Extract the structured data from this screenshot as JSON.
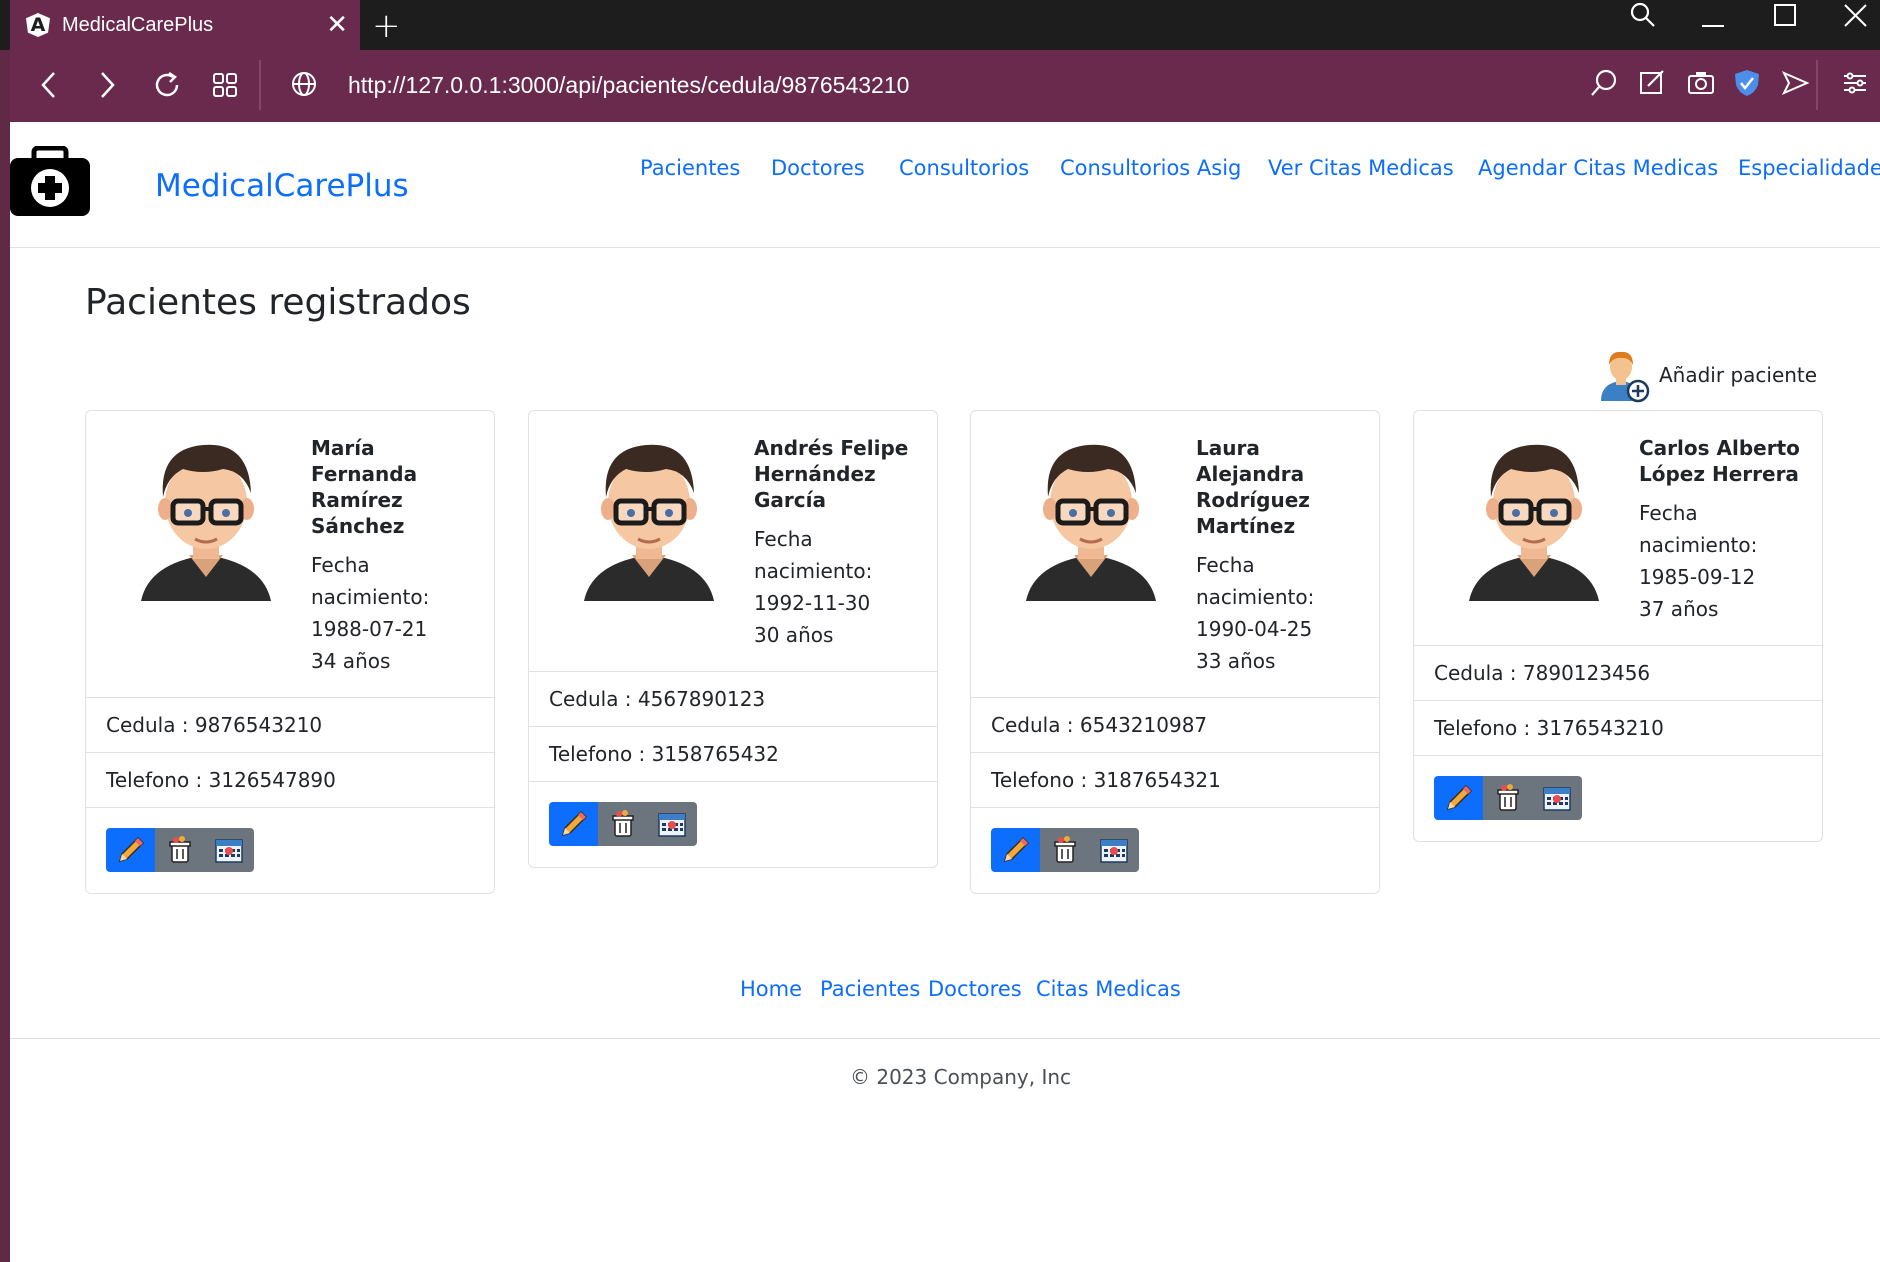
{
  "browser": {
    "tab_title": "MedicalCarePlus",
    "url": "http://127.0.0.1:3000/api/pacientes/cedula/9876543210",
    "colors": {
      "tabbar": "#1d1d1d",
      "chrome": "#692a4d"
    }
  },
  "site": {
    "brand": "MedicalCarePlus",
    "nav": [
      "Pacientes",
      "Doctores",
      "Consultorios",
      "Consultorios Asig",
      "Ver Citas Medicas",
      "Agendar Citas Medicas",
      "Especialidades"
    ]
  },
  "main": {
    "title": "Pacientes registrados",
    "add_patient_label": "Añadir paciente",
    "patients": [
      {
        "name": "María Fernanda Ramírez Sánchez",
        "birth_label": "Fecha nacimiento:",
        "birth_date": "1988-07-21",
        "age": "34 años",
        "cedula": "Cedula : 9876543210",
        "telefono": "Telefono : 3126547890"
      },
      {
        "name": "Andrés Felipe Hernández García",
        "birth_label": "Fecha nacimiento:",
        "birth_date": "1992-11-30",
        "age": "30 años",
        "cedula": "Cedula : 4567890123",
        "telefono": "Telefono : 3158765432"
      },
      {
        "name": "Laura Alejandra Rodríguez Martínez",
        "birth_label": "Fecha nacimiento:",
        "birth_date": "1990-04-25",
        "age": "33 años",
        "cedula": "Cedula : 6543210987",
        "telefono": "Telefono : 3187654321"
      },
      {
        "name": "Carlos Alberto López Herrera",
        "birth_label": "Fecha nacimiento:",
        "birth_date": "1985-09-12",
        "age": "37 años",
        "cedula": "Cedula : 7890123456",
        "telefono": "Telefono : 3176543210"
      }
    ],
    "icons": {
      "edit": "pencil-icon",
      "delete": "trash-icon",
      "schedule": "calendar-icon"
    },
    "colors": {
      "link": "#0d6efd",
      "edit_btn": "#0d6efd",
      "secondary_btn": "#6c757d"
    }
  },
  "footer": {
    "links": [
      "Home",
      "Pacientes",
      "Doctores",
      "Citas Medicas"
    ],
    "copyright": "© 2023 Company, Inc"
  }
}
